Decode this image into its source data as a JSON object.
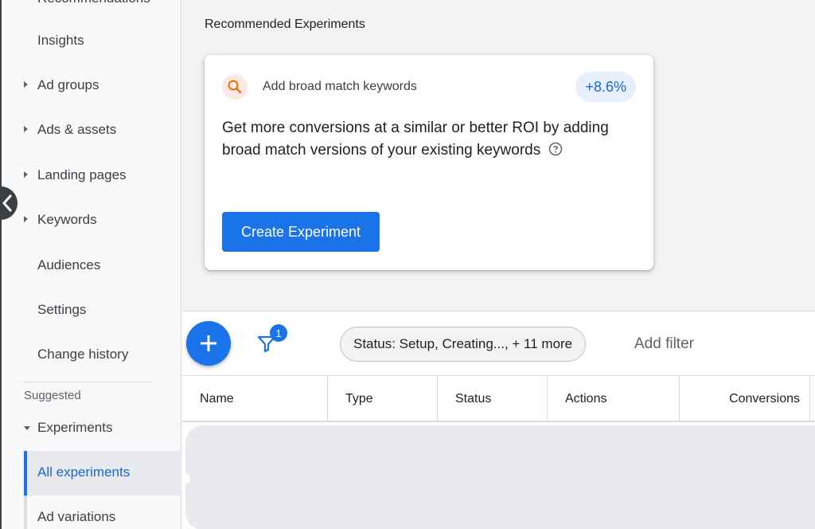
{
  "sidebar": {
    "items": [
      {
        "label": "Recommendations"
      },
      {
        "label": "Insights"
      },
      {
        "label": "Ad groups"
      },
      {
        "label": "Ads & assets"
      },
      {
        "label": "Landing pages"
      },
      {
        "label": "Keywords"
      },
      {
        "label": "Audiences"
      },
      {
        "label": "Settings"
      },
      {
        "label": "Change history"
      }
    ],
    "section_label": "Suggested",
    "group_label": "Experiments",
    "sub_items": [
      {
        "label": "All experiments",
        "active": true
      },
      {
        "label": "Ad variations"
      }
    ]
  },
  "recommended": {
    "title": "Recommended Experiments",
    "card": {
      "headline": "Add broad match keywords",
      "uplift": "+8.6%",
      "description": "Get more conversions at a similar or better ROI by adding broad match versions of your existing keywords",
      "cta": "Create Experiment"
    }
  },
  "toolbar": {
    "filter_count": "1",
    "status_chip": "Status: Setup, Creating..., + 11 more",
    "add_filter": "Add filter"
  },
  "table": {
    "columns": [
      "Name",
      "Type",
      "Status",
      "Actions",
      "Conversions"
    ]
  },
  "colors": {
    "accent": "#1a73e8",
    "pill_bg": "#e8f0fe",
    "search_badge_bg": "#fce8e6"
  }
}
